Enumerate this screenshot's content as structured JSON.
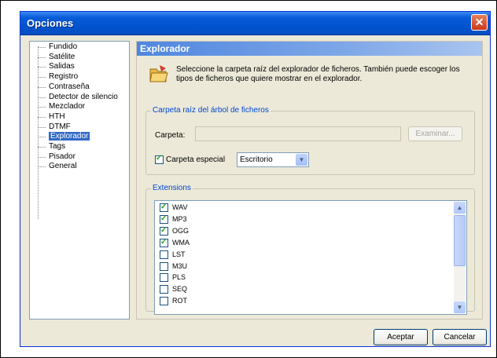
{
  "window": {
    "title": "Opciones",
    "close_label": "✕"
  },
  "tree": {
    "items": [
      {
        "label": "Fundido"
      },
      {
        "label": "Satélite"
      },
      {
        "label": "Salidas"
      },
      {
        "label": "Registro"
      },
      {
        "label": "Contraseña"
      },
      {
        "label": "Detector de silencio"
      },
      {
        "label": "Mezclador"
      },
      {
        "label": "HTH"
      },
      {
        "label": "DTMF"
      },
      {
        "label": "Explorador",
        "selected": true
      },
      {
        "label": "Tags"
      },
      {
        "label": "Pisador"
      },
      {
        "label": "General"
      }
    ]
  },
  "panel": {
    "title": "Explorador",
    "icon": "folder-icon",
    "description": "Seleccione la carpeta raíz del explorador de ficheros. También puede escoger los tipos de ficheros que quiere mostrar en el explorador.",
    "root_group": {
      "label": "Carpeta raíz del árbol de ficheros",
      "folder_label": "Carpeta:",
      "folder_value": "",
      "browse_label": "Examinar...",
      "special_label": "Carpeta especial",
      "special_checked": true,
      "special_value": "Escritorio"
    },
    "extensions_group": {
      "label": "Extensions",
      "items": [
        {
          "label": "WAV",
          "checked": true
        },
        {
          "label": "MP3",
          "checked": true
        },
        {
          "label": "OGG",
          "checked": true
        },
        {
          "label": "WMA",
          "checked": true
        },
        {
          "label": "LST",
          "checked": false
        },
        {
          "label": "M3U",
          "checked": false
        },
        {
          "label": "PLS",
          "checked": false
        },
        {
          "label": "SEQ",
          "checked": false
        },
        {
          "label": "ROT",
          "checked": false
        }
      ]
    }
  },
  "buttons": {
    "ok": "Aceptar",
    "cancel": "Cancelar"
  }
}
